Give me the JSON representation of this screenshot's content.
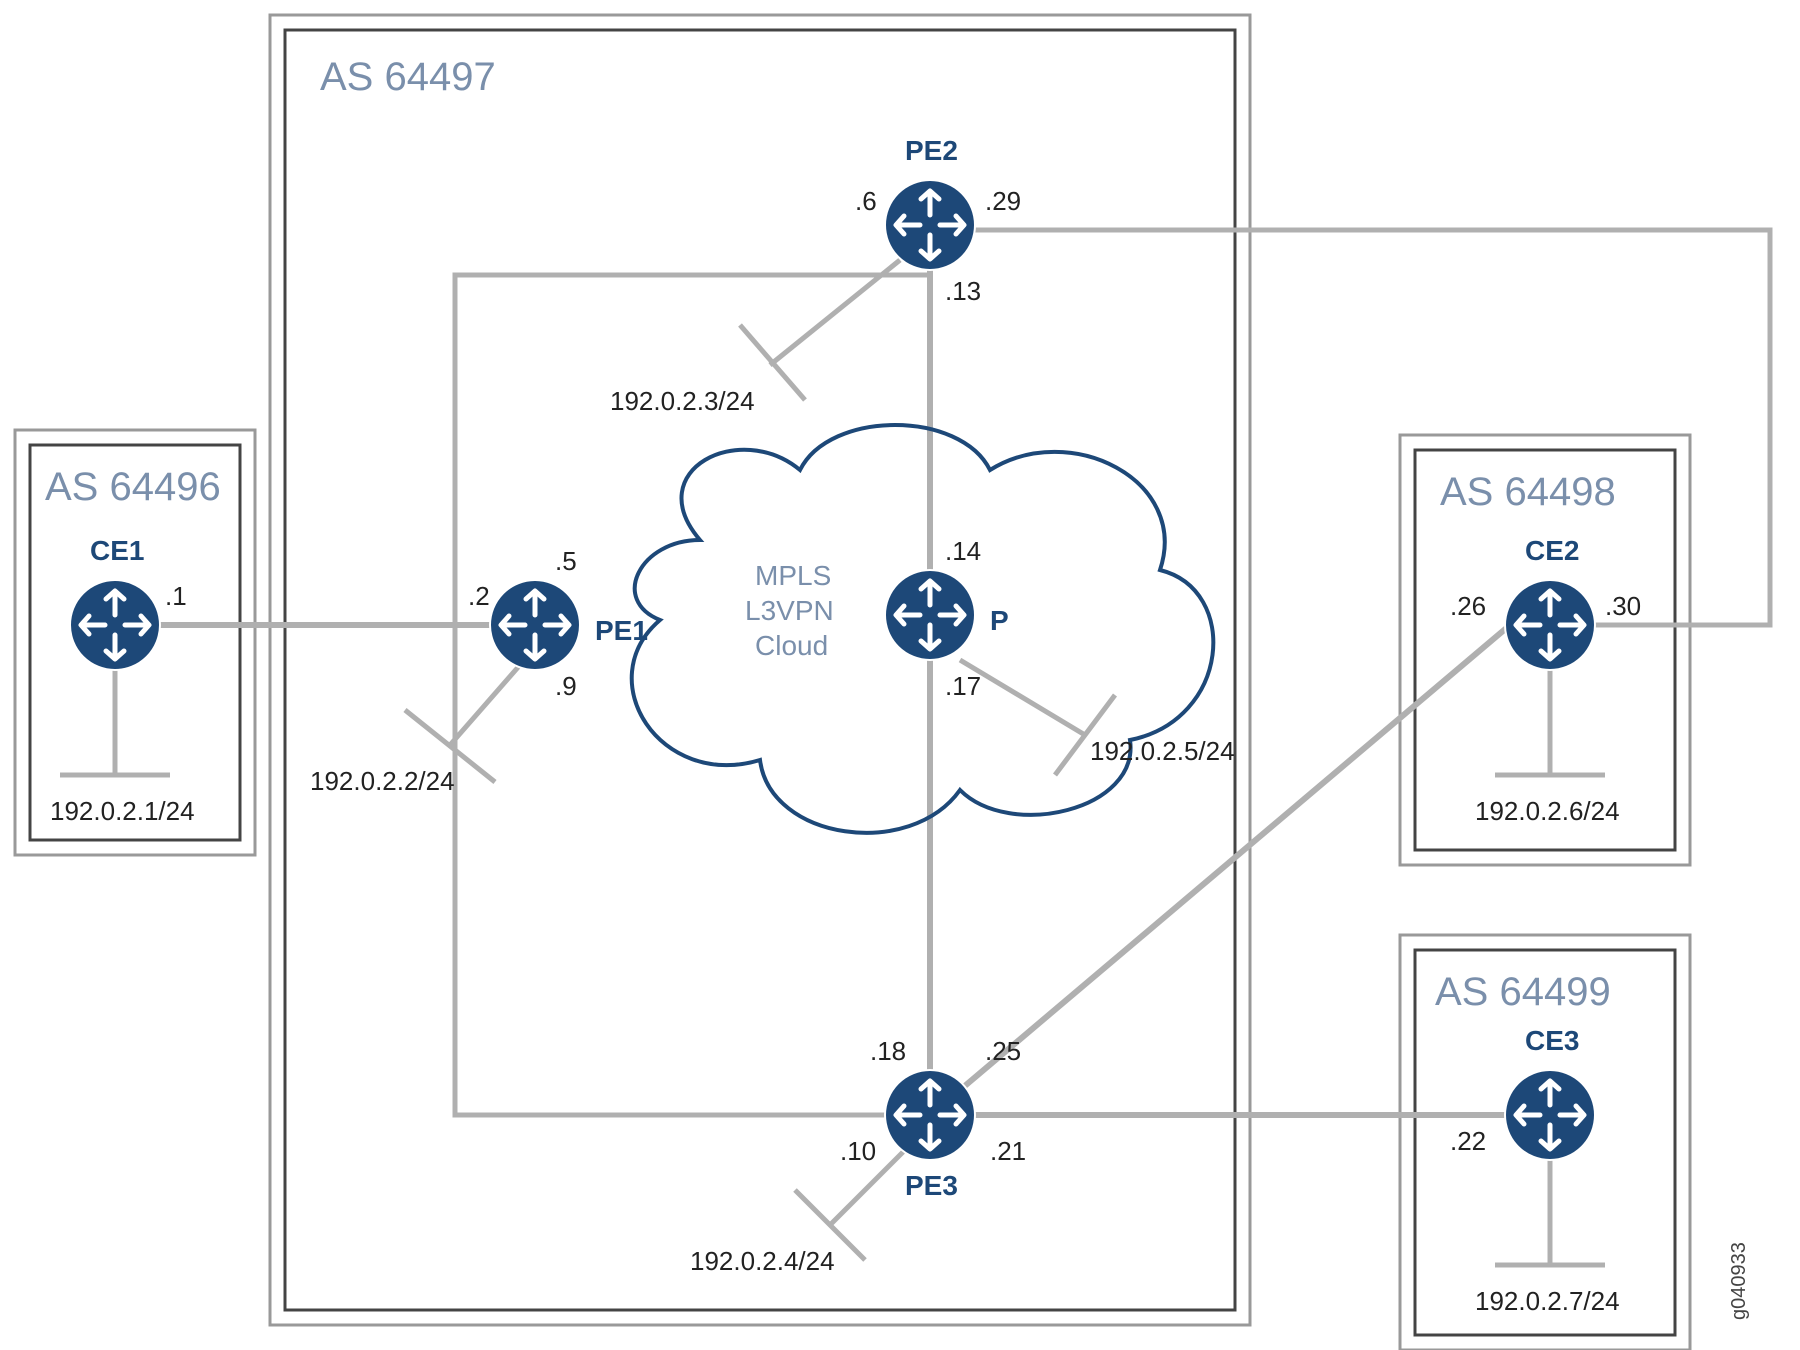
{
  "figure_id": "g040933",
  "as": {
    "a": "AS 64496",
    "b": "AS 64497",
    "c": "AS 64498",
    "d": "AS 64499"
  },
  "devices": {
    "ce1": "CE1",
    "ce2": "CE2",
    "ce3": "CE3",
    "pe1": "PE1",
    "pe2": "PE2",
    "pe3": "PE3",
    "p": "P"
  },
  "cloud": {
    "l1": "MPLS",
    "l2": "L3VPN",
    "l3": "Cloud"
  },
  "loopbacks": {
    "ce1": "192.0.2.1/24",
    "pe1": "192.0.2.2/24",
    "pe2": "192.0.2.3/24",
    "pe3": "192.0.2.4/24",
    "p": "192.0.2.5/24",
    "ce2": "192.0.2.6/24",
    "ce3": "192.0.2.7/24"
  },
  "if": {
    "ce1_1": ".1",
    "pe1_2": ".2",
    "pe1_5": ".5",
    "pe1_9": ".9",
    "pe2_6": ".6",
    "pe2_13": ".13",
    "pe2_29": ".29",
    "p_14": ".14",
    "p_17": ".17",
    "pe3_10": ".10",
    "pe3_18": ".18",
    "pe3_21": ".21",
    "pe3_25": ".25",
    "ce2_26": ".26",
    "ce2_30": ".30",
    "ce3_22": ".22"
  }
}
